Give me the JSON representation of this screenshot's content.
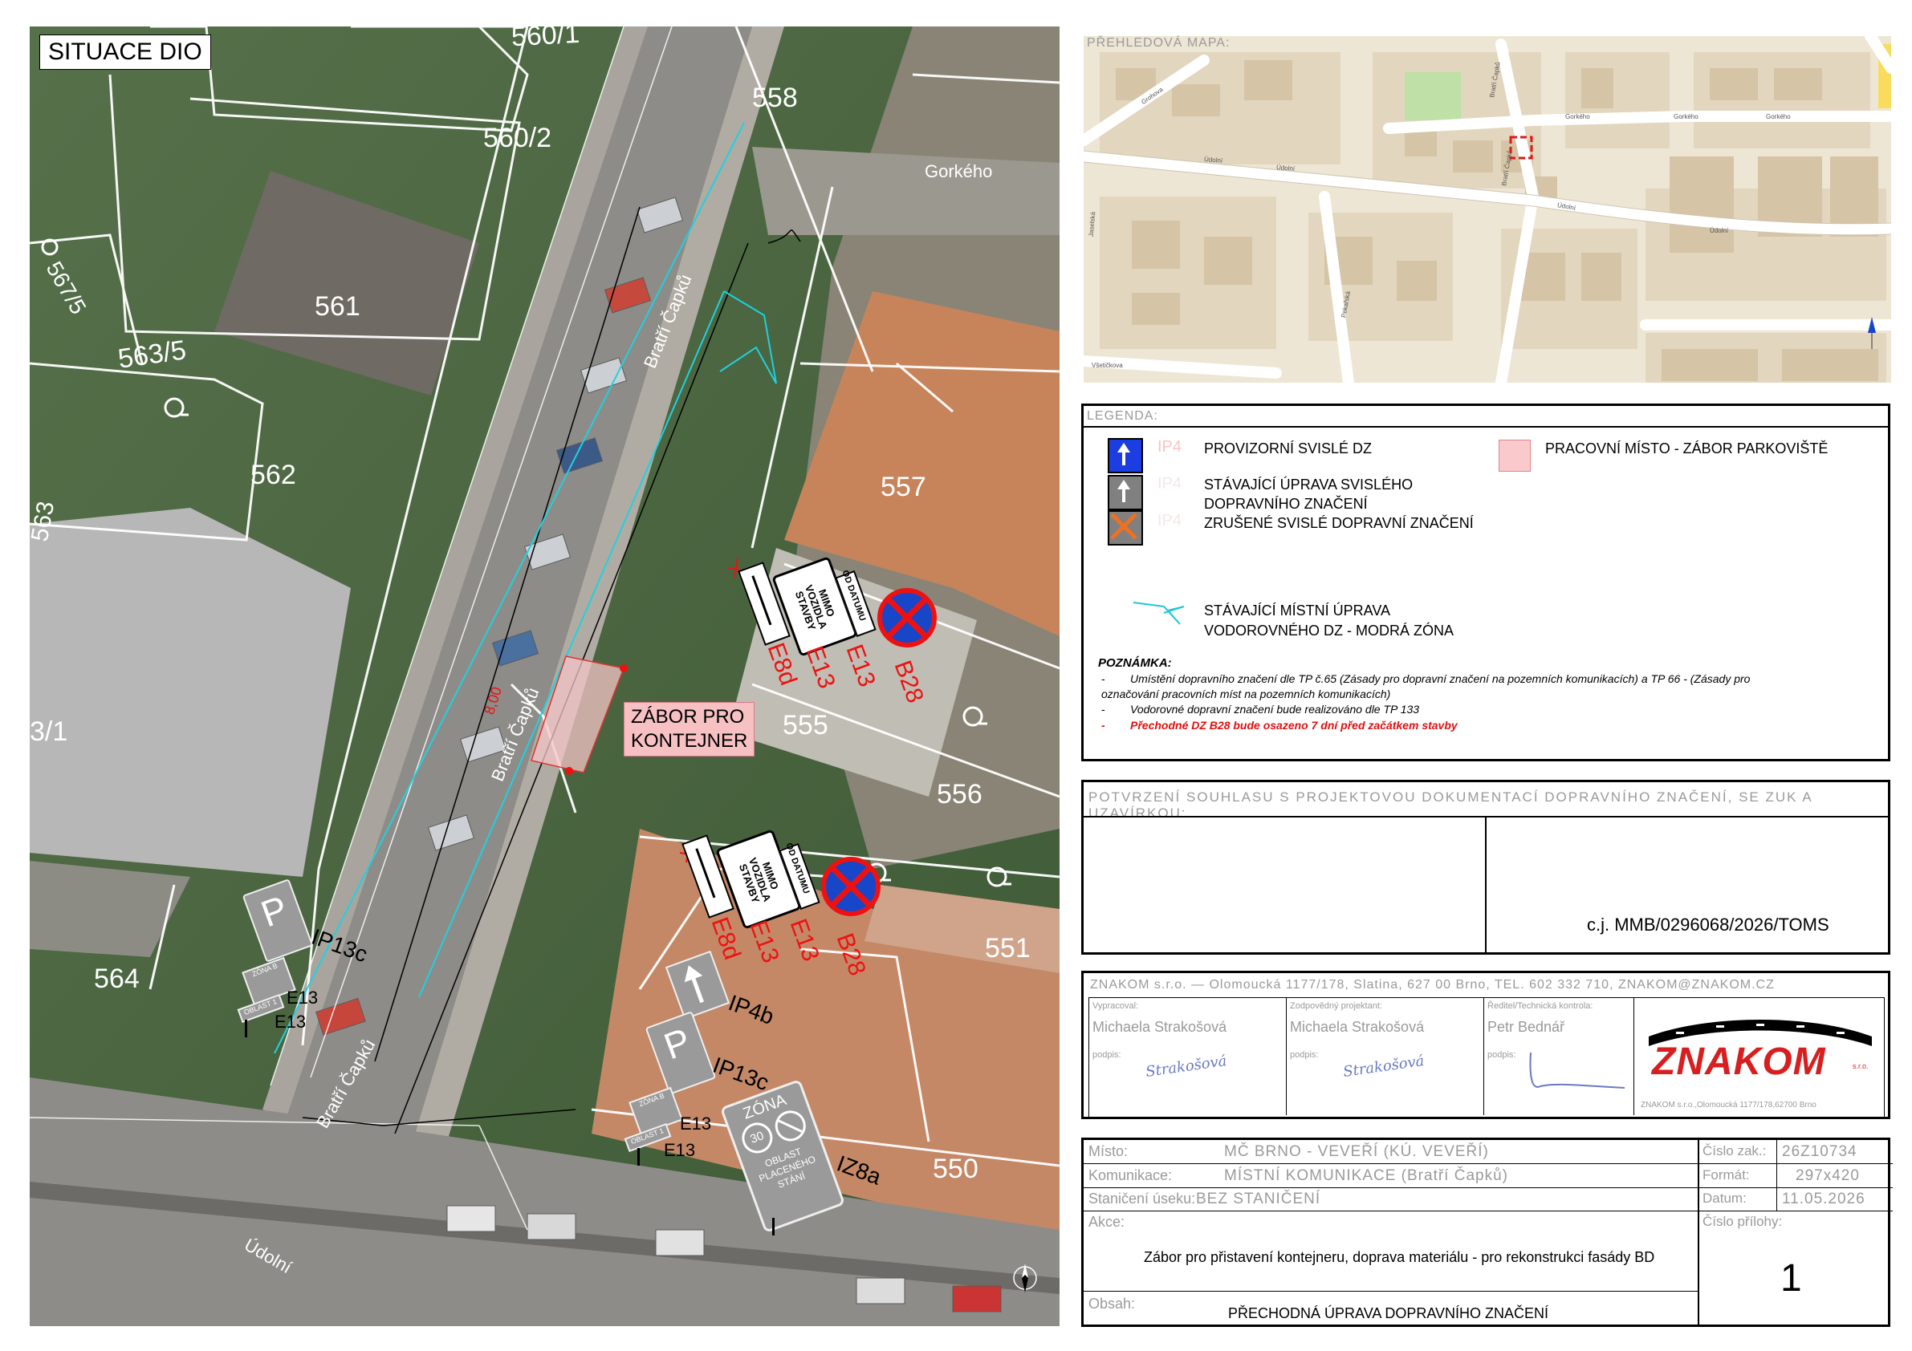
{
  "situation": {
    "title": "SITUACE DIO",
    "parcels": [
      "560/1",
      "558",
      "560/2",
      "567/5",
      "561",
      "563/5",
      "562",
      "563",
      "557",
      "555",
      "556",
      "3/1",
      "564",
      "551",
      "550"
    ],
    "streets": {
      "gorkeho": "Gorkého",
      "bratri_capku": "Bratří Čapků",
      "udolni": "Údolní"
    },
    "dimension": "8,00",
    "zabor_label": [
      "ZÁBOR PRO",
      "KONTEJNER"
    ],
    "signs_top": {
      "e8d": "E8d",
      "e13a": "E13",
      "e13b": "E13",
      "b28": "B28",
      "mimo": [
        "MIMO",
        "VOZIDLA",
        "STAVBY"
      ],
      "od_datumu": "OD DATUMU"
    },
    "signs_bottom": {
      "e8d": "E8d",
      "e13a": "E13",
      "e13b": "E13",
      "b28": "B28",
      "mimo": [
        "MIMO",
        "VOZIDLA",
        "STAVBY"
      ],
      "od_datumu": "OD DATUMU"
    },
    "left_group": {
      "ip13c": "IP13c",
      "zona_b": "ZÓNA B",
      "oblast": "OBLAST 1",
      "e13a": "E13",
      "e13b": "E13"
    },
    "right_group": {
      "ip4b": "IP4b",
      "ip13c": "IP13c",
      "zona_b": "ZÓNA B",
      "oblast": "OBLAST 1",
      "e13a": "E13",
      "e13b": "E13",
      "iz8a": "IZ8a",
      "zona": "ZÓNA",
      "speed": "30",
      "oblast_text": [
        "OBLAST",
        "PLACENÉHO",
        "STÁNÍ"
      ]
    }
  },
  "overview_map": {
    "title": "PŘEHLEDOVÁ MAPA:",
    "streets": [
      "Gorkého",
      "Gorkého",
      "Gorkého",
      "Údolní",
      "Údolní",
      "Údolní",
      "Údolní",
      "Bratří Čapků",
      "Bratří Čapků",
      "Grohova",
      "Všetičkova",
      "Jaselská",
      "Pekařská"
    ]
  },
  "legend": {
    "title": "LEGENDA:",
    "items": [
      {
        "code": "IP4",
        "text": "PROVIZORNÍ SVISLÉ DZ",
        "color": "#1c3ee0"
      },
      {
        "code": "IP4",
        "text": "STÁVAJÍCÍ ÚPRAVA SVISLÉHO",
        "text2": "DOPRAVNÍHO ZNAČENÍ",
        "color": "#808080"
      },
      {
        "code": "IP4",
        "text": "ZRUŠENÉ SVISLÉ DOPRAVNÍ ZNAČENÍ",
        "color": "#f07020"
      },
      {
        "code": "",
        "text": "PRACOVNÍ MÍSTO - ZÁBOR PARKOVIŠTĚ",
        "color": "#f9c9cb"
      },
      {
        "code": "",
        "text": "STÁVAJÍCÍ  MÍSTNÍ ÚPRAVA",
        "text2": "VODOROVNÉHO DZ - MODRÁ ZÓNA",
        "color": "#20c8d8"
      }
    ],
    "note_title": "POZNÁMKA:",
    "notes": [
      "Umístění dopravního značení dle TP č.65 (Zásady pro dopravní značení na pozemních komunikacích) a TP 66 - (Zásady pro",
      "označování pracovních míst na pozemních komunikacích)",
      "Vodorovné dopravní značení bude realizováno dle TP 133"
    ],
    "note_red": "Přechodné DZ B28 bude osazeno 7 dní před začátkem stavby"
  },
  "approval": {
    "title": "POTVRZENÍ SOUHLASU S PROJEKTOVOU DOKUMENTACÍ DOPRAVNÍHO ZNAČENÍ, SE ZUK A UZAVÍRKOU:",
    "ref": "c.j. MMB/0296068/2026/TOMS"
  },
  "company": {
    "header": "ZNAKOM s.r.o. — Olomoucká 1177/178, Slatina, 627 00 Brno, TEL. 602 332 710, ZNAKOM@ZNAKOM.CZ",
    "roles": [
      {
        "role": "Vypracoval:",
        "name": "Michaela Strakošová",
        "sig_label": "podpis:",
        "sig": "Strakošová"
      },
      {
        "role": "Zodpovědný projektant:",
        "name": "Michaela Strakošová",
        "sig_label": "podpis:",
        "sig": "Strakošová"
      },
      {
        "role": "Ředitel/Technická kontrola:",
        "name": "Petr Bednář",
        "sig_label": "podpis:",
        "sig": ""
      }
    ],
    "logo": "ZNAKOM",
    "logo_sub": "s.r.o.",
    "logo_address": "ZNAKOM s.r.o.,Olomoucká 1177/178,62700 Brno"
  },
  "titleblock": {
    "misto_label": "Místo:",
    "misto": "MČ BRNO - VEVEŘÍ (KÚ. VEVEŘÍ)",
    "komunikace_label": "Komunikace:",
    "komunikace": "MÍSTNÍ KOMUNIKACE (Bratří Čapků)",
    "stanic_label": "Staničení úseku:",
    "stanic": "BEZ STANIČENÍ",
    "cislo_zak_label": "Číslo zak.:",
    "cislo_zak": "26Z10734",
    "format_label": "Formát:",
    "format": "297x420",
    "datum_label": "Datum:",
    "datum": "11.05.2026",
    "akce_label": "Akce:",
    "akce": "Zábor pro přistavení kontejneru, doprava materiálu - pro rekonstrukci fasády BD",
    "cislo_prilohy_label": "Číslo přílohy:",
    "cislo_prilohy": "1",
    "obsah_label": "Obsah:",
    "obsah": "PŘECHODNÁ ÚPRAVA DOPRAVNÍHO ZNAČENÍ"
  }
}
